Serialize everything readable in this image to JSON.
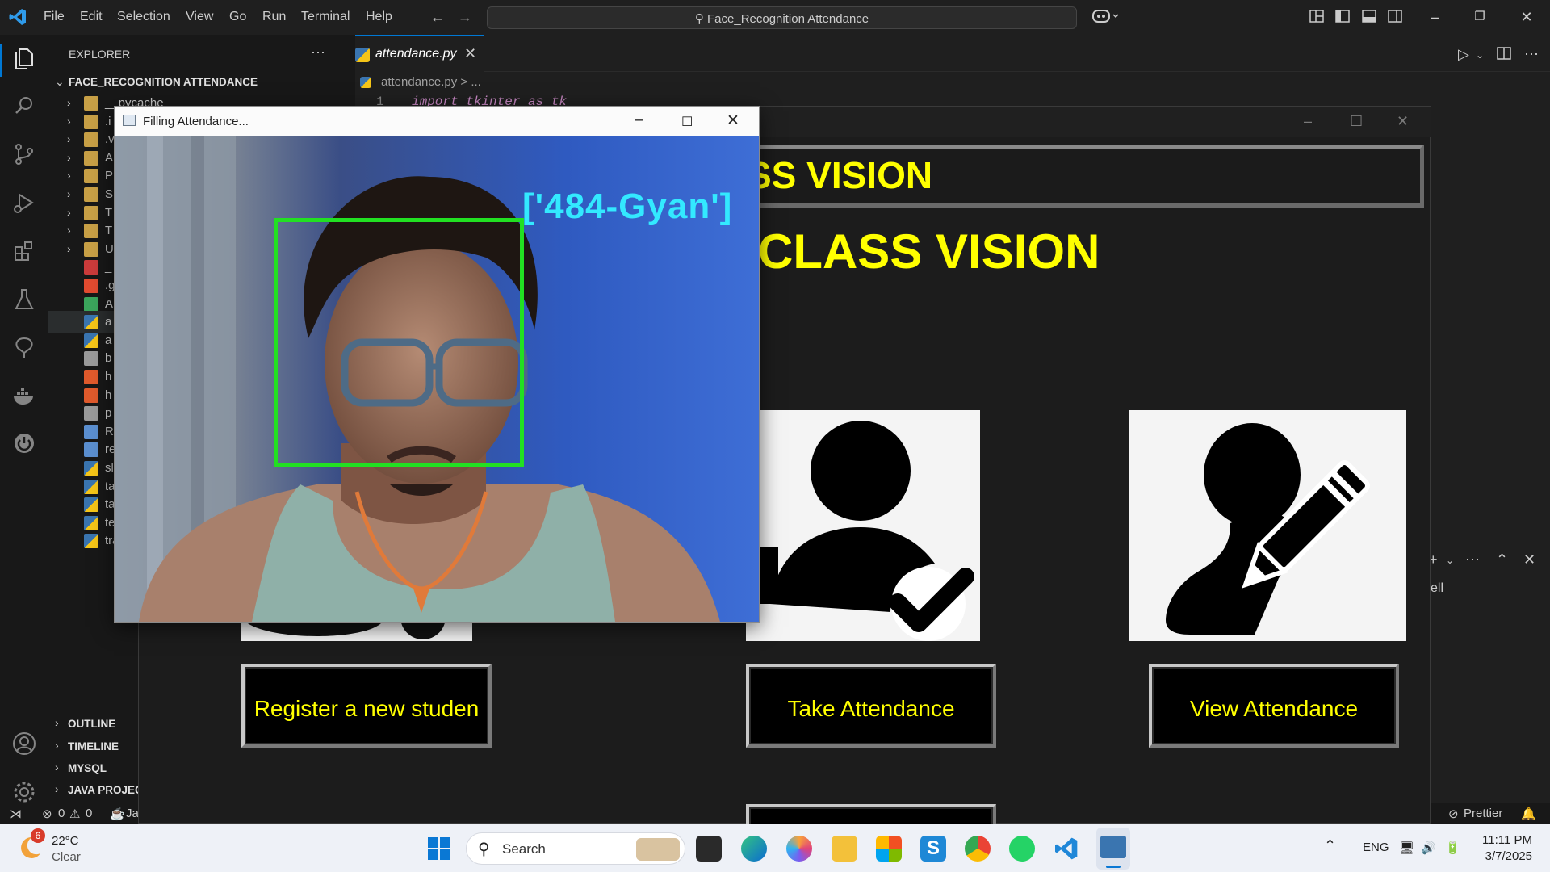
{
  "vscode": {
    "menu": [
      "File",
      "Edit",
      "Selection",
      "View",
      "Go",
      "Run",
      "Terminal",
      "Help"
    ],
    "command_center": "Face_Recognition Attendance",
    "explorer": {
      "header": "EXPLORER",
      "root": "FACE_RECOGNITION ATTENDANCE",
      "items": [
        {
          "name": "__pycache__",
          "type": "folder"
        },
        {
          "name": ".i",
          "type": "folder"
        },
        {
          "name": ".v",
          "type": "folder"
        },
        {
          "name": "A",
          "type": "folder"
        },
        {
          "name": "P",
          "type": "folder"
        },
        {
          "name": "S",
          "type": "folder"
        },
        {
          "name": "T",
          "type": "folder"
        },
        {
          "name": "T",
          "type": "folder"
        },
        {
          "name": "U",
          "type": "folder"
        },
        {
          "name": "_",
          "type": "file-yml"
        },
        {
          "name": ".g",
          "type": "file-git"
        },
        {
          "name": "A",
          "type": "file-image"
        },
        {
          "name": "a",
          "type": "file-py"
        },
        {
          "name": "a",
          "type": "file-py"
        },
        {
          "name": "b",
          "type": "file"
        },
        {
          "name": "h",
          "type": "file-html"
        },
        {
          "name": "h",
          "type": "file-html"
        },
        {
          "name": "p",
          "type": "file-text"
        },
        {
          "name": "R",
          "type": "file-md"
        },
        {
          "name": "re",
          "type": "file-req"
        },
        {
          "name": "sl",
          "type": "file-py"
        },
        {
          "name": "ta",
          "type": "file-py"
        },
        {
          "name": "ta",
          "type": "file-py"
        },
        {
          "name": "te",
          "type": "file-py"
        },
        {
          "name": "trainIr",
          "type": "file-py"
        }
      ],
      "sections": [
        "OUTLINE",
        "TIMELINE",
        "MYSQL",
        "JAVA PROJEC"
      ]
    },
    "tab": {
      "name": "attendance.py",
      "close": "✕"
    },
    "breadcrumb": "attendance.py > ...",
    "code_line": "import tkinter as tk",
    "line_number": "1",
    "panel_text": "ell",
    "status": {
      "errors": "0",
      "warnings": "0",
      "java": "Ja",
      "prettier": "Prettier"
    }
  },
  "tk_window": {
    "banner": "SS VISION",
    "title": "CLASS VISION",
    "buttons": {
      "register": "Register a new studen",
      "take": "Take Attendance",
      "view": "View Attendance"
    }
  },
  "camera_window": {
    "title": "Filling Attendance...",
    "label": "['484-Gyan']",
    "box_color": "#22e022",
    "label_color": "#33e9ff"
  },
  "taskbar": {
    "weather": {
      "temp": "22°C",
      "condition": "Clear",
      "badge": "6"
    },
    "search": "Search",
    "lang": "ENG",
    "time": "11:11 PM",
    "date": "3/7/2025"
  },
  "colors": {
    "accent": "#0078d4",
    "tk_text": "#ffff00"
  }
}
